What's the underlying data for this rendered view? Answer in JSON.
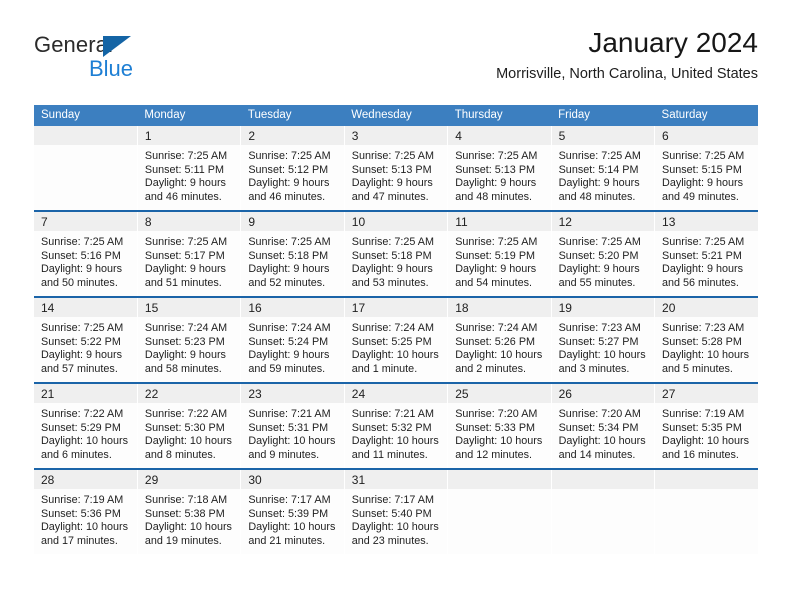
{
  "brand": {
    "name_part1": "General",
    "name_part2": "Blue",
    "triangle_color": "#1464a5",
    "blue_color": "#1e7fd4"
  },
  "header": {
    "title": "January 2024",
    "subtitle": "Morrisville, North Carolina, United States",
    "header_bg": "#3c7fc0",
    "row_divider": "#1b64a8",
    "daynum_bg": "#efefef"
  },
  "weekdays": [
    "Sunday",
    "Monday",
    "Tuesday",
    "Wednesday",
    "Thursday",
    "Friday",
    "Saturday"
  ],
  "labels": {
    "sunrise": "Sunrise:",
    "sunset": "Sunset:",
    "daylight": "Daylight:"
  },
  "weeks": [
    [
      {
        "day": "",
        "sunrise": "",
        "sunset": "",
        "daylight_line1": "",
        "daylight_line2": ""
      },
      {
        "day": "1",
        "sunrise": "Sunrise: 7:25 AM",
        "sunset": "Sunset: 5:11 PM",
        "daylight_line1": "Daylight: 9 hours",
        "daylight_line2": "and 46 minutes."
      },
      {
        "day": "2",
        "sunrise": "Sunrise: 7:25 AM",
        "sunset": "Sunset: 5:12 PM",
        "daylight_line1": "Daylight: 9 hours",
        "daylight_line2": "and 46 minutes."
      },
      {
        "day": "3",
        "sunrise": "Sunrise: 7:25 AM",
        "sunset": "Sunset: 5:13 PM",
        "daylight_line1": "Daylight: 9 hours",
        "daylight_line2": "and 47 minutes."
      },
      {
        "day": "4",
        "sunrise": "Sunrise: 7:25 AM",
        "sunset": "Sunset: 5:13 PM",
        "daylight_line1": "Daylight: 9 hours",
        "daylight_line2": "and 48 minutes."
      },
      {
        "day": "5",
        "sunrise": "Sunrise: 7:25 AM",
        "sunset": "Sunset: 5:14 PM",
        "daylight_line1": "Daylight: 9 hours",
        "daylight_line2": "and 48 minutes."
      },
      {
        "day": "6",
        "sunrise": "Sunrise: 7:25 AM",
        "sunset": "Sunset: 5:15 PM",
        "daylight_line1": "Daylight: 9 hours",
        "daylight_line2": "and 49 minutes."
      }
    ],
    [
      {
        "day": "7",
        "sunrise": "Sunrise: 7:25 AM",
        "sunset": "Sunset: 5:16 PM",
        "daylight_line1": "Daylight: 9 hours",
        "daylight_line2": "and 50 minutes."
      },
      {
        "day": "8",
        "sunrise": "Sunrise: 7:25 AM",
        "sunset": "Sunset: 5:17 PM",
        "daylight_line1": "Daylight: 9 hours",
        "daylight_line2": "and 51 minutes."
      },
      {
        "day": "9",
        "sunrise": "Sunrise: 7:25 AM",
        "sunset": "Sunset: 5:18 PM",
        "daylight_line1": "Daylight: 9 hours",
        "daylight_line2": "and 52 minutes."
      },
      {
        "day": "10",
        "sunrise": "Sunrise: 7:25 AM",
        "sunset": "Sunset: 5:18 PM",
        "daylight_line1": "Daylight: 9 hours",
        "daylight_line2": "and 53 minutes."
      },
      {
        "day": "11",
        "sunrise": "Sunrise: 7:25 AM",
        "sunset": "Sunset: 5:19 PM",
        "daylight_line1": "Daylight: 9 hours",
        "daylight_line2": "and 54 minutes."
      },
      {
        "day": "12",
        "sunrise": "Sunrise: 7:25 AM",
        "sunset": "Sunset: 5:20 PM",
        "daylight_line1": "Daylight: 9 hours",
        "daylight_line2": "and 55 minutes."
      },
      {
        "day": "13",
        "sunrise": "Sunrise: 7:25 AM",
        "sunset": "Sunset: 5:21 PM",
        "daylight_line1": "Daylight: 9 hours",
        "daylight_line2": "and 56 minutes."
      }
    ],
    [
      {
        "day": "14",
        "sunrise": "Sunrise: 7:25 AM",
        "sunset": "Sunset: 5:22 PM",
        "daylight_line1": "Daylight: 9 hours",
        "daylight_line2": "and 57 minutes."
      },
      {
        "day": "15",
        "sunrise": "Sunrise: 7:24 AM",
        "sunset": "Sunset: 5:23 PM",
        "daylight_line1": "Daylight: 9 hours",
        "daylight_line2": "and 58 minutes."
      },
      {
        "day": "16",
        "sunrise": "Sunrise: 7:24 AM",
        "sunset": "Sunset: 5:24 PM",
        "daylight_line1": "Daylight: 9 hours",
        "daylight_line2": "and 59 minutes."
      },
      {
        "day": "17",
        "sunrise": "Sunrise: 7:24 AM",
        "sunset": "Sunset: 5:25 PM",
        "daylight_line1": "Daylight: 10 hours",
        "daylight_line2": "and 1 minute."
      },
      {
        "day": "18",
        "sunrise": "Sunrise: 7:24 AM",
        "sunset": "Sunset: 5:26 PM",
        "daylight_line1": "Daylight: 10 hours",
        "daylight_line2": "and 2 minutes."
      },
      {
        "day": "19",
        "sunrise": "Sunrise: 7:23 AM",
        "sunset": "Sunset: 5:27 PM",
        "daylight_line1": "Daylight: 10 hours",
        "daylight_line2": "and 3 minutes."
      },
      {
        "day": "20",
        "sunrise": "Sunrise: 7:23 AM",
        "sunset": "Sunset: 5:28 PM",
        "daylight_line1": "Daylight: 10 hours",
        "daylight_line2": "and 5 minutes."
      }
    ],
    [
      {
        "day": "21",
        "sunrise": "Sunrise: 7:22 AM",
        "sunset": "Sunset: 5:29 PM",
        "daylight_line1": "Daylight: 10 hours",
        "daylight_line2": "and 6 minutes."
      },
      {
        "day": "22",
        "sunrise": "Sunrise: 7:22 AM",
        "sunset": "Sunset: 5:30 PM",
        "daylight_line1": "Daylight: 10 hours",
        "daylight_line2": "and 8 minutes."
      },
      {
        "day": "23",
        "sunrise": "Sunrise: 7:21 AM",
        "sunset": "Sunset: 5:31 PM",
        "daylight_line1": "Daylight: 10 hours",
        "daylight_line2": "and 9 minutes."
      },
      {
        "day": "24",
        "sunrise": "Sunrise: 7:21 AM",
        "sunset": "Sunset: 5:32 PM",
        "daylight_line1": "Daylight: 10 hours",
        "daylight_line2": "and 11 minutes."
      },
      {
        "day": "25",
        "sunrise": "Sunrise: 7:20 AM",
        "sunset": "Sunset: 5:33 PM",
        "daylight_line1": "Daylight: 10 hours",
        "daylight_line2": "and 12 minutes."
      },
      {
        "day": "26",
        "sunrise": "Sunrise: 7:20 AM",
        "sunset": "Sunset: 5:34 PM",
        "daylight_line1": "Daylight: 10 hours",
        "daylight_line2": "and 14 minutes."
      },
      {
        "day": "27",
        "sunrise": "Sunrise: 7:19 AM",
        "sunset": "Sunset: 5:35 PM",
        "daylight_line1": "Daylight: 10 hours",
        "daylight_line2": "and 16 minutes."
      }
    ],
    [
      {
        "day": "28",
        "sunrise": "Sunrise: 7:19 AM",
        "sunset": "Sunset: 5:36 PM",
        "daylight_line1": "Daylight: 10 hours",
        "daylight_line2": "and 17 minutes."
      },
      {
        "day": "29",
        "sunrise": "Sunrise: 7:18 AM",
        "sunset": "Sunset: 5:38 PM",
        "daylight_line1": "Daylight: 10 hours",
        "daylight_line2": "and 19 minutes."
      },
      {
        "day": "30",
        "sunrise": "Sunrise: 7:17 AM",
        "sunset": "Sunset: 5:39 PM",
        "daylight_line1": "Daylight: 10 hours",
        "daylight_line2": "and 21 minutes."
      },
      {
        "day": "31",
        "sunrise": "Sunrise: 7:17 AM",
        "sunset": "Sunset: 5:40 PM",
        "daylight_line1": "Daylight: 10 hours",
        "daylight_line2": "and 23 minutes."
      },
      {
        "day": "",
        "sunrise": "",
        "sunset": "",
        "daylight_line1": "",
        "daylight_line2": ""
      },
      {
        "day": "",
        "sunrise": "",
        "sunset": "",
        "daylight_line1": "",
        "daylight_line2": ""
      },
      {
        "day": "",
        "sunrise": "",
        "sunset": "",
        "daylight_line1": "",
        "daylight_line2": ""
      }
    ]
  ]
}
